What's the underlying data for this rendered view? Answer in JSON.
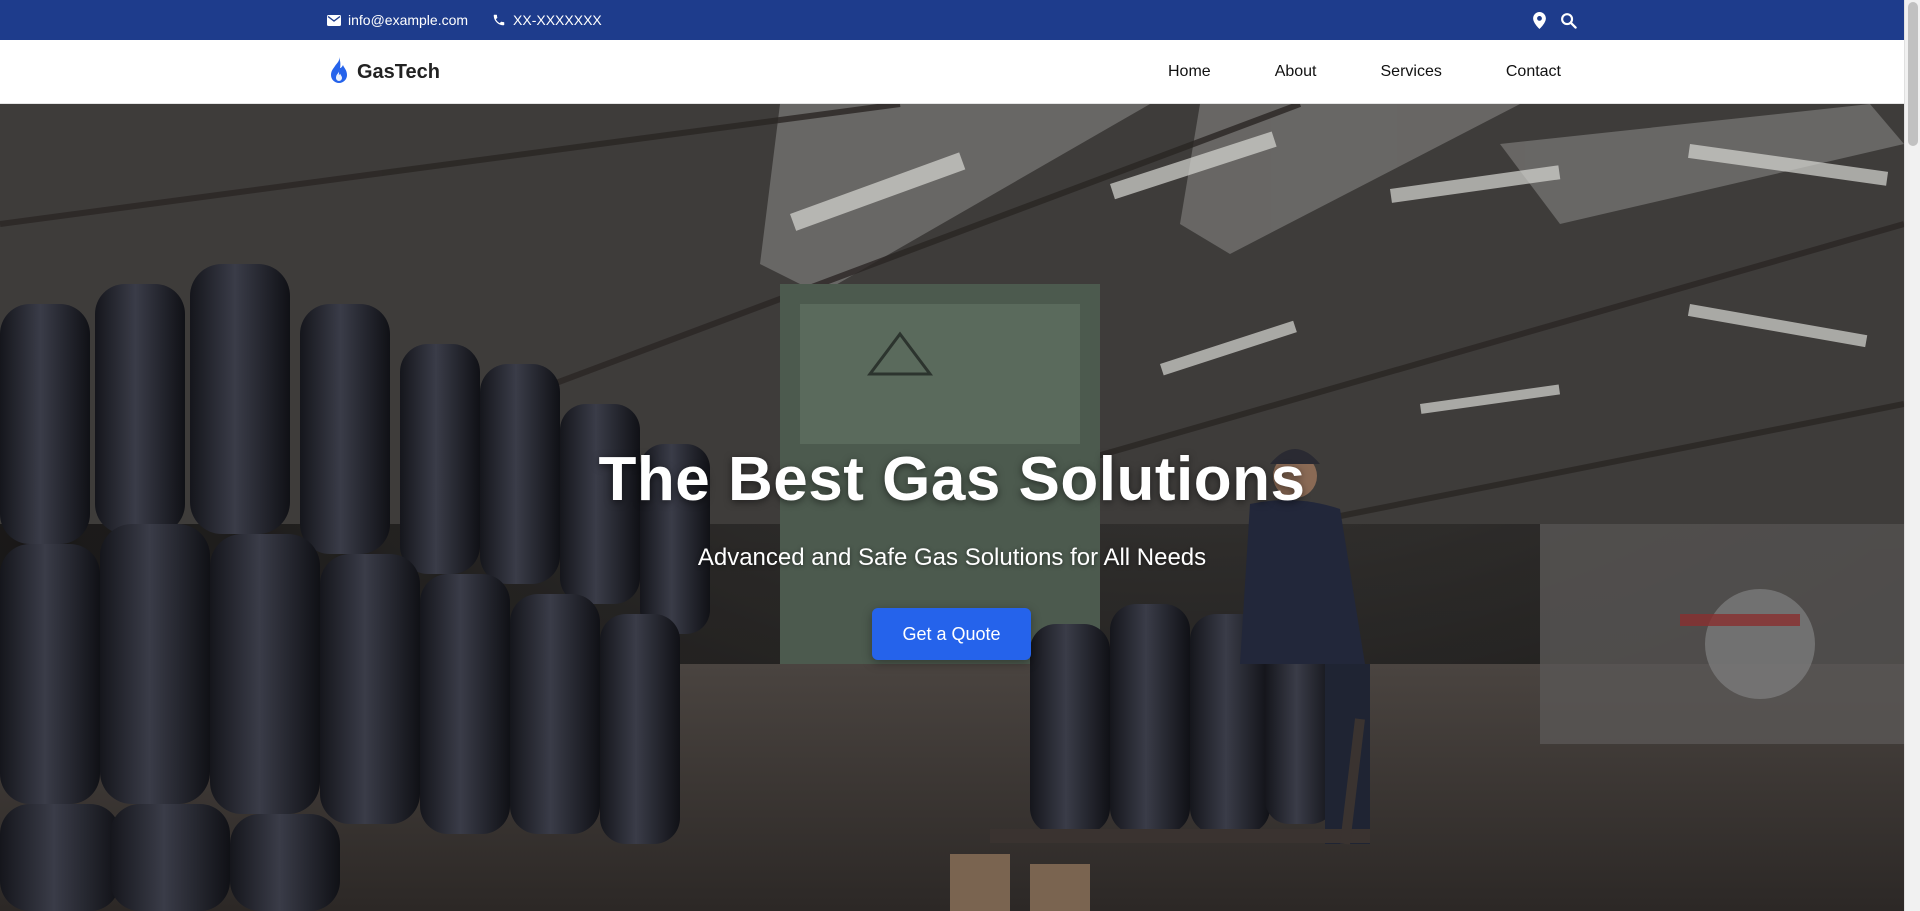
{
  "topbar": {
    "email": "info@example.com",
    "phone": "XX-XXXXXXX",
    "icons": [
      "envelope-icon",
      "phone-icon",
      "map-pin-icon",
      "search-icon"
    ],
    "background": "#1e3c8c"
  },
  "navbar": {
    "brand": "GasTech",
    "brand_icon": "flame-icon",
    "links": [
      "Home",
      "About",
      "Services",
      "Contact"
    ]
  },
  "hero": {
    "title": "The Best Gas Solutions",
    "subtitle": "Advanced and Safe Gas Solutions for All Needs",
    "cta_label": "Get a Quote",
    "cta_color": "#2563eb"
  }
}
